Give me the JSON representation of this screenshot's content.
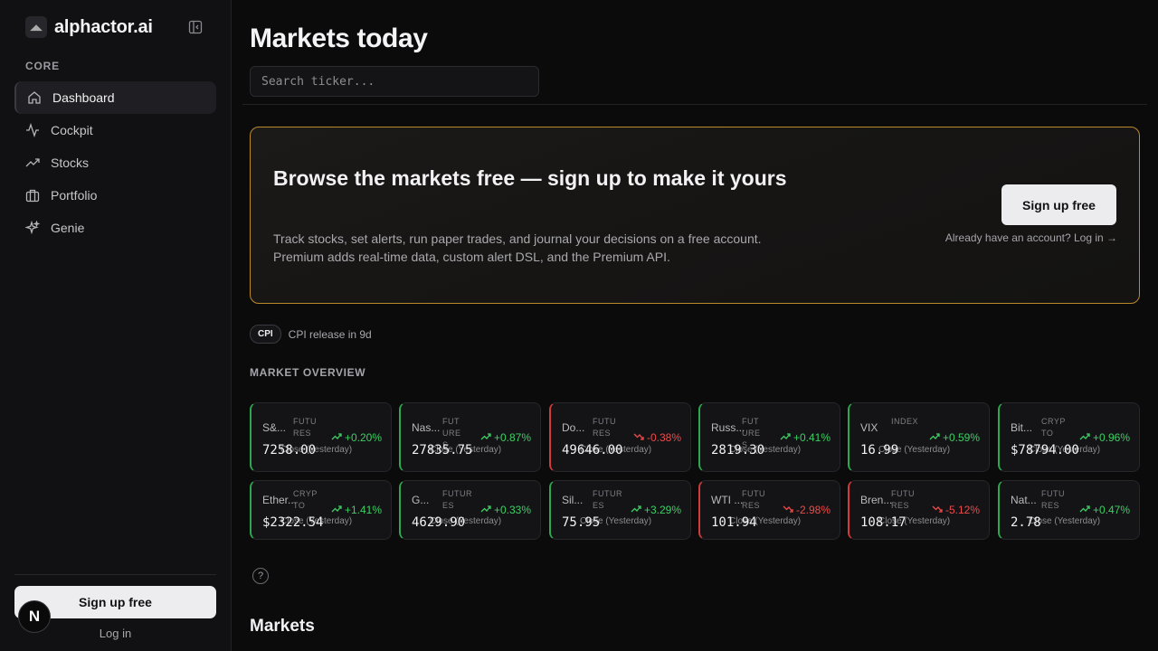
{
  "brand": {
    "name": "alphactor.ai"
  },
  "sidebar": {
    "section": "CORE",
    "items": [
      {
        "label": "Dashboard",
        "icon": "home-icon"
      },
      {
        "label": "Cockpit",
        "icon": "activity-icon"
      },
      {
        "label": "Stocks",
        "icon": "trending-up-icon"
      },
      {
        "label": "Portfolio",
        "icon": "briefcase-icon"
      },
      {
        "label": "Genie",
        "icon": "sparkles-icon"
      }
    ],
    "signup": "Sign up free",
    "login": "Log in"
  },
  "header": {
    "title": "Markets today",
    "search_placeholder": "Search ticker..."
  },
  "banner": {
    "title": "Browse the markets free — sign up to make it yours",
    "desc": "Track stocks, set alerts, run paper trades, and journal your decisions on a free account. Premium adds real-time data, custom alert DSL, and the Premium API.",
    "button": "Sign up free",
    "login": "Already have an account? Log in →"
  },
  "cpi": {
    "tag": "CPI",
    "text": "CPI release in 9d"
  },
  "overview": {
    "label": "MARKET OVERVIEW",
    "tiles": [
      {
        "name": "S&...",
        "type": "FUTU RES",
        "change": "+0.20%",
        "dir": "up",
        "price": "7258.00",
        "close": "Close (Yesterday)"
      },
      {
        "name": "Nas...",
        "type": "FUT URE S",
        "change": "+0.87%",
        "dir": "up",
        "price": "27835.75",
        "close": "Close (Yesterday)"
      },
      {
        "name": "Do...",
        "type": "FUTU RES",
        "change": "-0.38%",
        "dir": "down",
        "price": "49646.00",
        "close": "Close (Yesterday)"
      },
      {
        "name": "Russ...",
        "type": "FUT URE S",
        "change": "+0.41%",
        "dir": "up",
        "price": "2819.30",
        "close": "Close (Yesterday)"
      },
      {
        "name": "VIX",
        "type": "INDEX",
        "change": "+0.59%",
        "dir": "up",
        "price": "16.99",
        "close": "Close (Yesterday)"
      },
      {
        "name": "Bit...",
        "type": "CRYP TO",
        "change": "+0.96%",
        "dir": "up",
        "price": "$78794.00",
        "close": "Close (Yesterday)"
      },
      {
        "name": "Ether...",
        "type": "CRYP TO",
        "change": "+1.41%",
        "dir": "up",
        "price": "$2322.54",
        "close": "Close (Yesterday)"
      },
      {
        "name": "G...",
        "type": "FUTUR ES",
        "change": "+0.33%",
        "dir": "up",
        "price": "4629.90",
        "close": "Close (Yesterday)"
      },
      {
        "name": "Sil...",
        "type": "FUTUR ES",
        "change": "+3.29%",
        "dir": "up",
        "price": "75.95",
        "close": "Close (Yesterday)"
      },
      {
        "name": "WTI ...",
        "type": "FUTU RES",
        "change": "-2.98%",
        "dir": "down",
        "price": "101.94",
        "close": "Close (Yesterday)"
      },
      {
        "name": "Bren...",
        "type": "FUTU RES",
        "change": "-5.12%",
        "dir": "down",
        "price": "108.17",
        "close": "Close (Yesterday)"
      },
      {
        "name": "Nat...",
        "type": "FUTU RES",
        "change": "+0.47%",
        "dir": "up",
        "price": "2.78",
        "close": "Close (Yesterday)"
      }
    ]
  },
  "markets": {
    "title": "Markets"
  },
  "colors": {
    "up": "#3ccf65",
    "down": "#ef4a4a",
    "accent": "#b98a2a"
  }
}
